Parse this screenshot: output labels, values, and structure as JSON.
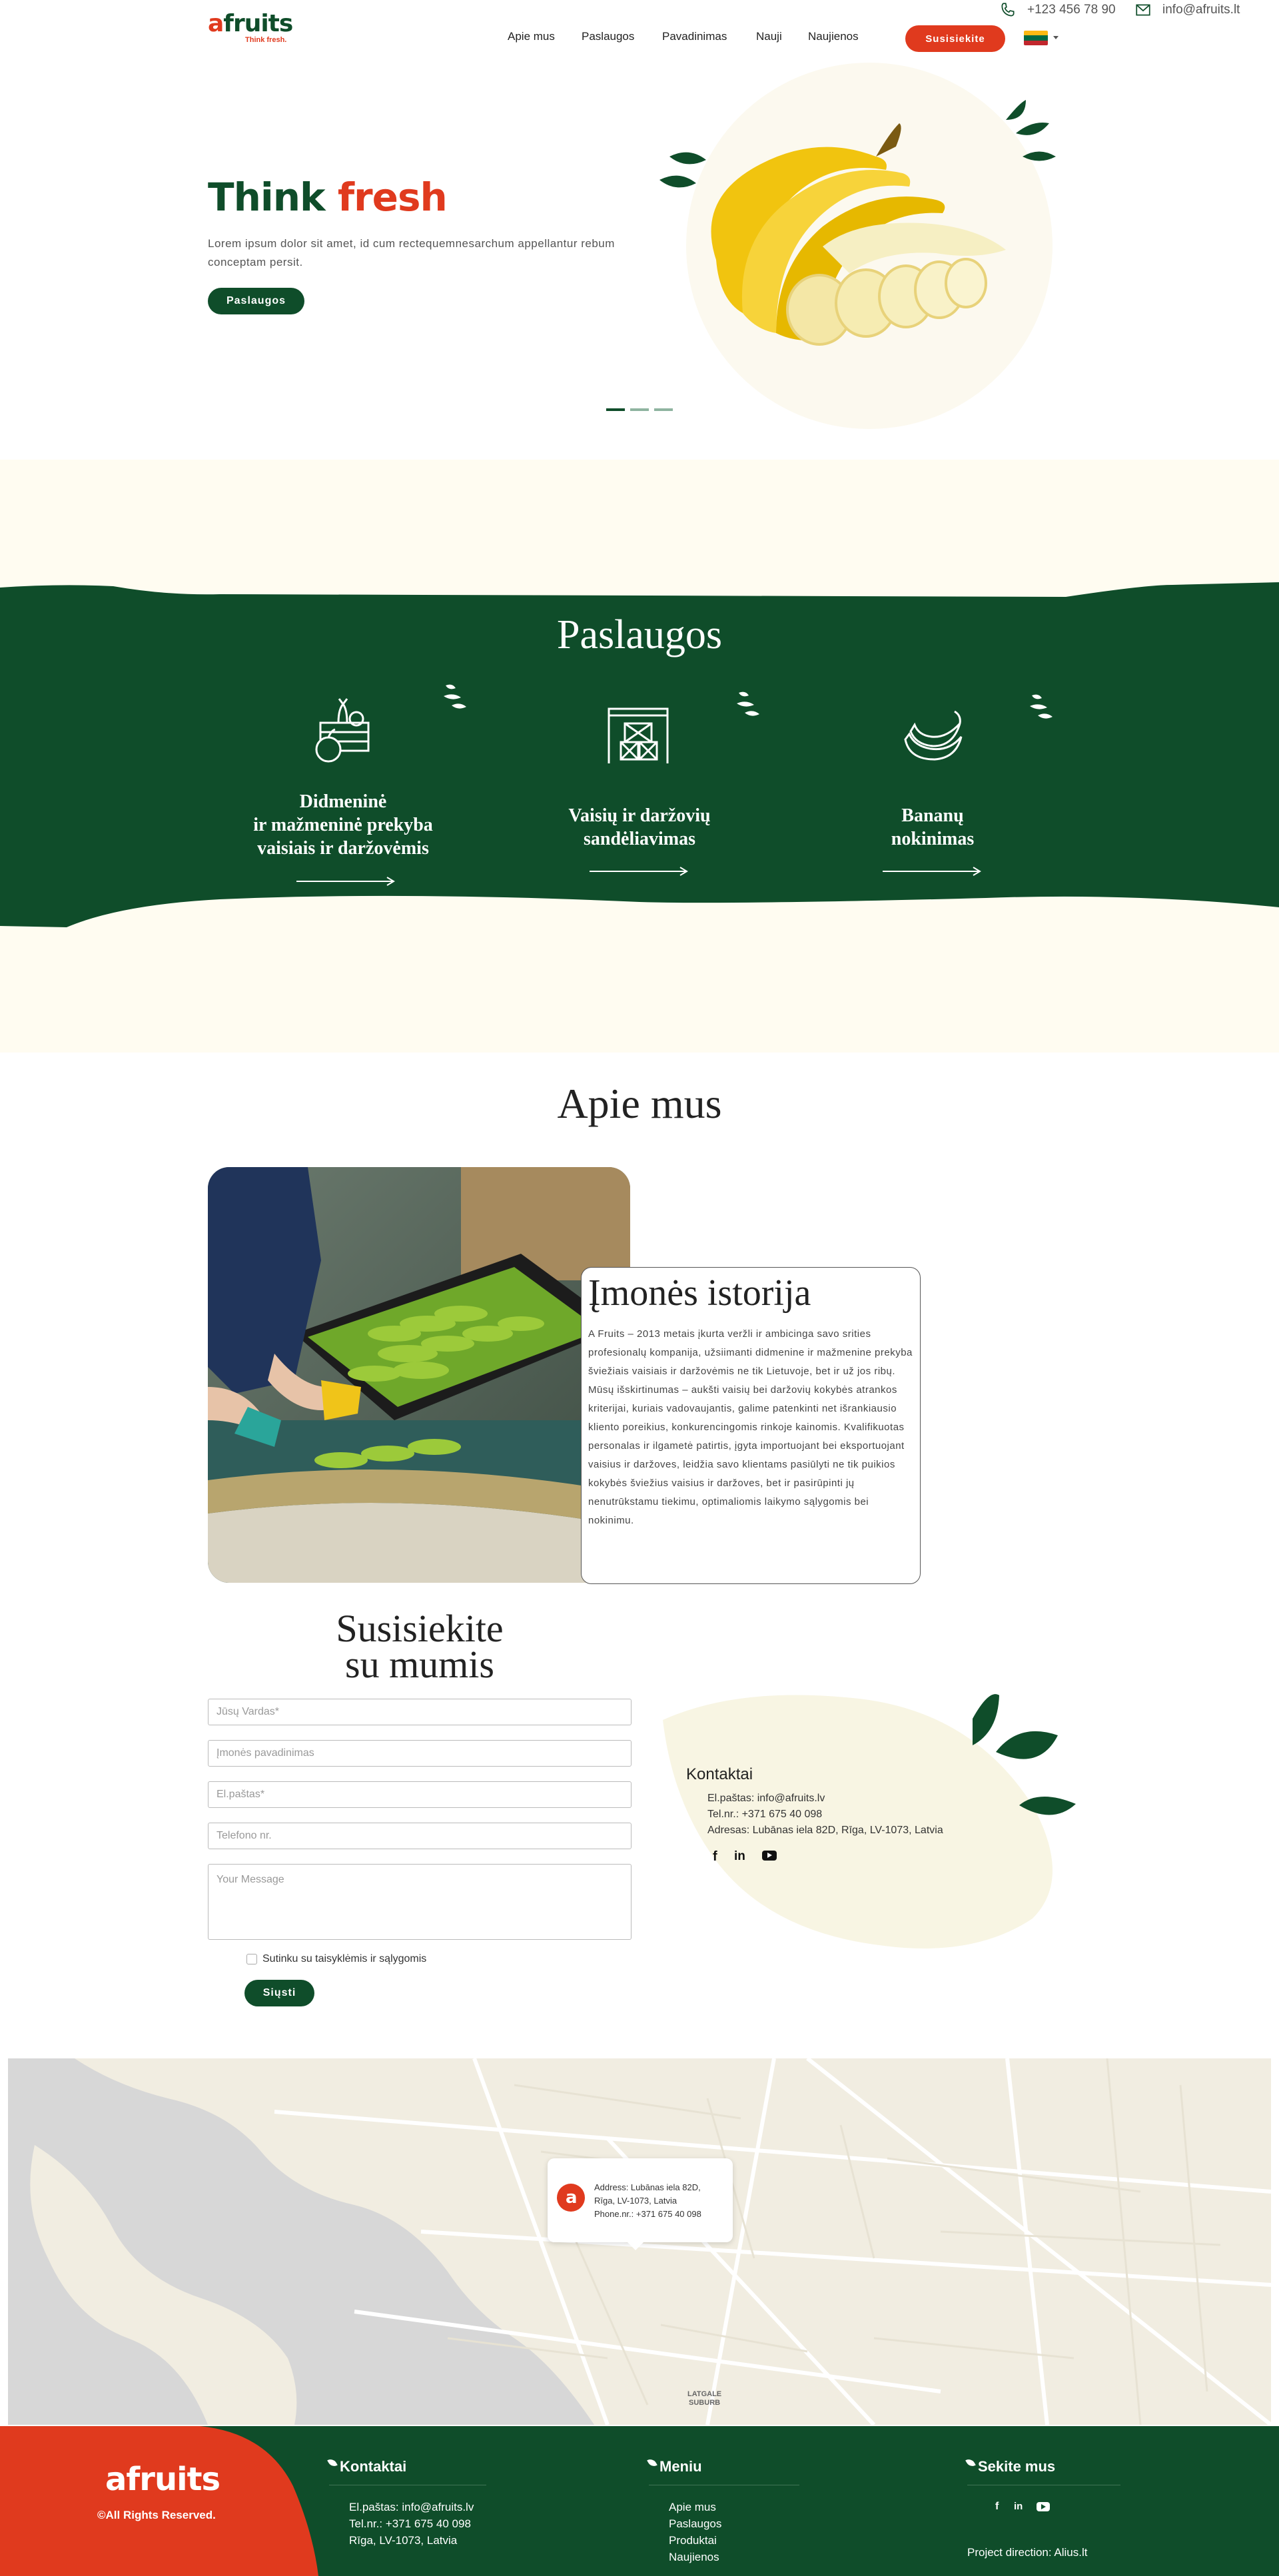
{
  "topbar": {
    "phone": "+123 456 78 90",
    "email": "info@afruits.lt"
  },
  "header": {
    "logo_main": "afruits",
    "logo_tagline": "Think fresh.",
    "nav": [
      "Apie mus",
      "Paslaugos",
      "Pavadinimas",
      "Nauji",
      "Naujienos"
    ],
    "cta": "Susisiekite"
  },
  "hero": {
    "title_1": "Think",
    "title_2": "fresh",
    "text": "Lorem ipsum dolor sit amet, id cum rectequemnesarchum appellantur rebum conceptam persit.",
    "button": "Paslaugos"
  },
  "services": {
    "heading": "Paslaugos",
    "items": [
      {
        "title": "Didmeninė\nir mažmeninė prekyba\nvaisiais ir daržovėmis",
        "icon": "fruit-crate-icon"
      },
      {
        "title": "Vaisių ir daržovių\nsandėliavimas",
        "icon": "warehouse-icon"
      },
      {
        "title": "Bananų\nnokinimas",
        "icon": "banana-icon"
      }
    ]
  },
  "about": {
    "heading": "Apie mus",
    "card_title": "Įmonės istorija",
    "card_text": "A Fruits – 2013 metais įkurta veržli ir ambicinga savo srities profesionalų kompanija, užsiimanti didmenine ir mažmenine prekyba šviežiais vaisiais ir daržovėmis ne tik Lietuvoje, bet ir už jos ribų. Mūsų išskirtinumas – aukšti vaisių bei daržovių kokybės atrankos kriterijai, kuriais vadovaujantis, galime patenkinti net išrankiausio kliento poreikius, konkurencingomis rinkoje kainomis. Kvalifikuotas personalas ir ilgametė patirtis, įgyta importuojant bei eksportuojant vaisius ir daržoves, leidžia savo klientams pasiūlyti ne tik puikios kokybės šviežius vaisius ir daržoves, bet ir pasirūpinti jų nenutrūkstamu tiekimu, optimaliomis laikymo sąlygomis bei nokinimu."
  },
  "contact_form": {
    "heading_1": "Susisiekite",
    "heading_2": "su mumis",
    "name_placeholder": "Jūsų Vardas*",
    "company_placeholder": "Įmonės pavadinimas",
    "email_placeholder": "El.paštas*",
    "phone_placeholder": "Telefono nr.",
    "message_placeholder": "Your Message",
    "consent": "Sutinku su taisyklėmis ir sąlygomis",
    "submit": "Siųsti"
  },
  "contacts": {
    "heading": "Kontaktai",
    "email": "El.paštas: info@afruits.lv",
    "phone": "Tel.nr.: +371 675 40 098",
    "address": "Adresas: Lubānas iela 82D, Rīga, LV-1073, Latvia"
  },
  "map": {
    "addr_1": "Address: Lubānas iela 82D,",
    "addr_2": "Rīga, LV-1073, Latvia",
    "phone": "Phone.nr.: +371 675 40 098",
    "district": "LATGALE\nSUBURB"
  },
  "footer": {
    "logo": "afruits",
    "rights": "©All Rights Reserved.",
    "contacts_h": "Kontaktai",
    "contacts": [
      "El.paštas: info@afruits.lv",
      "Tel.nr.: +371 675 40 098",
      "Rīga, LV-1073, Latvia"
    ],
    "menu_h": "Meniu",
    "menu": [
      "Apie mus",
      "Paslaugos",
      "Produktai",
      "Naujienos"
    ],
    "follow_h": "Sekite mus",
    "direction": "Project direction: Alius.lt"
  },
  "colors": {
    "green": "#0f4d2a",
    "red": "#e03a1e",
    "cream": "#fffcf1"
  }
}
